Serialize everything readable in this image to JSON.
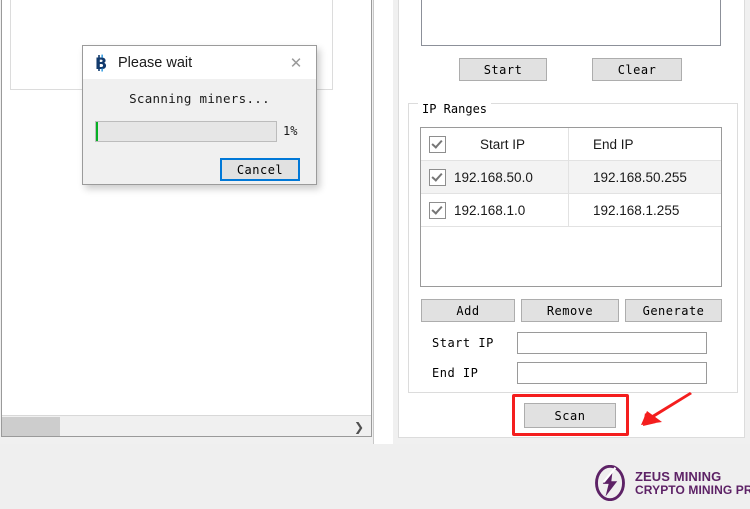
{
  "dialog": {
    "title": "Please wait",
    "icon": "bitcoin-icon",
    "close_glyph": "✕",
    "message": "Scanning miners...",
    "progress_percent": 1,
    "progress_label": "1%",
    "progress_color": "#06b025",
    "cancel_label": "Cancel",
    "focus_color": "#0078d7"
  },
  "left_panel": {
    "scroll_arrow_glyph": "❯"
  },
  "right_panel": {
    "log_box_value": "",
    "start_label": "Start",
    "clear_label": "Clear",
    "ip_ranges": {
      "group_label": "IP Ranges",
      "columns": [
        "Start IP",
        "End IP"
      ],
      "header_checked": true,
      "rows": [
        {
          "checked": true,
          "start_ip": "192.168.50.0",
          "end_ip": "192.168.50.255",
          "selected": true
        },
        {
          "checked": true,
          "start_ip": "192.168.1.0",
          "end_ip": "192.168.1.255",
          "selected": false
        }
      ],
      "add_label": "Add",
      "remove_label": "Remove",
      "generate_label": "Generate",
      "start_ip_label": "Start IP",
      "end_ip_label": "End IP",
      "start_ip_value": "",
      "end_ip_value": "",
      "start_ip_placeholder": "",
      "end_ip_placeholder": ""
    },
    "scan_label": "Scan",
    "highlight_color": "#f41e1e"
  },
  "branding": {
    "line1": "ZEUS MINING",
    "line2": "CRYPTO MINING PRO",
    "color": "#5d2266",
    "mark": "zeus-bolt-icon"
  }
}
